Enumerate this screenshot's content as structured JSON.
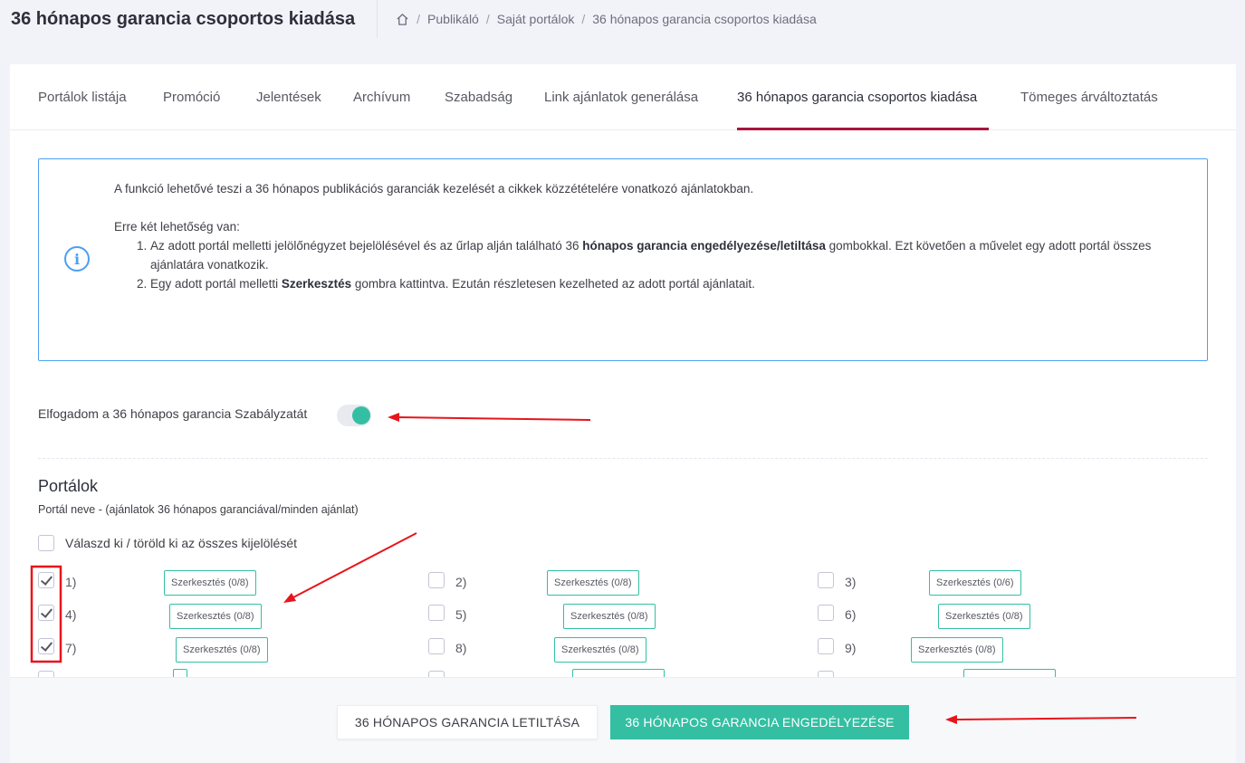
{
  "header": {
    "title": "36 hónapos garancia csoportos kiadása",
    "breadcrumb": [
      "Publikáló",
      "Saját portálok",
      "36 hónapos garancia csoportos kiadása"
    ],
    "breadcrumb_sep": "/"
  },
  "tabs": [
    {
      "label": "Portálok listája",
      "active": false
    },
    {
      "label": "Promóció",
      "active": false
    },
    {
      "label": "Jelentések",
      "active": false
    },
    {
      "label": "Archívum",
      "active": false
    },
    {
      "label": "Szabadság",
      "active": false
    },
    {
      "label": "Link ajánlatok generálása",
      "active": false
    },
    {
      "label": "36 hónapos garancia csoportos kiadása",
      "active": true
    },
    {
      "label": "Tömeges árváltoztatás",
      "active": false
    }
  ],
  "info": {
    "icon": "info-circle-icon",
    "intro": "A funkció lehetővé teszi a 36 hónapos publikációs garanciák kezelését a cikkek közzétételére vonatkozó ajánlatokban.",
    "options_title": "Erre két lehetőség van:",
    "item1_a": "Az adott portál melletti jelölőnégyzet bejelölésével és az űrlap alján található 36 ",
    "item1_b": "hónapos garancia engedélyezése/letiltása",
    "item1_c": " gombokkal. Ezt követően a művelet egy adott portál összes ajánlatára vonatkozik.",
    "item2_a": "Egy adott portál melletti ",
    "item2_b": "Szerkesztés",
    "item2_c": " gombra kattintva. Ezután részletesen kezelheted az adott portál ajánlatait."
  },
  "terms": {
    "label": "Elfogadom a 36 hónapos garancia Szabályzatát",
    "enabled": true
  },
  "portals": {
    "title": "Portálok",
    "subtitle": "Portál neve - (ajánlatok 36 hónapos garanciával/minden ajánlat)",
    "select_all_label": "Válaszd ki / töröld ki az összes kijelölését",
    "items": [
      {
        "label": "1)",
        "checked": true,
        "edit": "Szerkesztés (0/8)"
      },
      {
        "label": "2)",
        "checked": false,
        "edit": "Szerkesztés (0/8)"
      },
      {
        "label": "3)",
        "checked": false,
        "edit": "Szerkesztés (0/6)"
      },
      {
        "label": "4)",
        "checked": true,
        "edit": "Szerkesztés (0/8)"
      },
      {
        "label": "5)",
        "checked": false,
        "edit": "Szerkesztés (0/8)"
      },
      {
        "label": "6)",
        "checked": false,
        "edit": "Szerkesztés (0/8)"
      },
      {
        "label": "7)",
        "checked": true,
        "edit": "Szerkesztés (0/8)"
      },
      {
        "label": "8)",
        "checked": false,
        "edit": "Szerkesztés (0/8)"
      },
      {
        "label": "9)",
        "checked": false,
        "edit": "Szerkesztés (0/8)"
      }
    ]
  },
  "footer": {
    "disable_label": "36 HÓNAPOS GARANCIA LETILTÁSA",
    "enable_label": "36 HÓNAPOS GARANCIA ENGEDÉLYEZÉSE"
  },
  "colors": {
    "accent": "#34bfa3",
    "active_tab": "#a8163d",
    "info_border": "#4c9ff2",
    "annotation": "#e8141b"
  }
}
